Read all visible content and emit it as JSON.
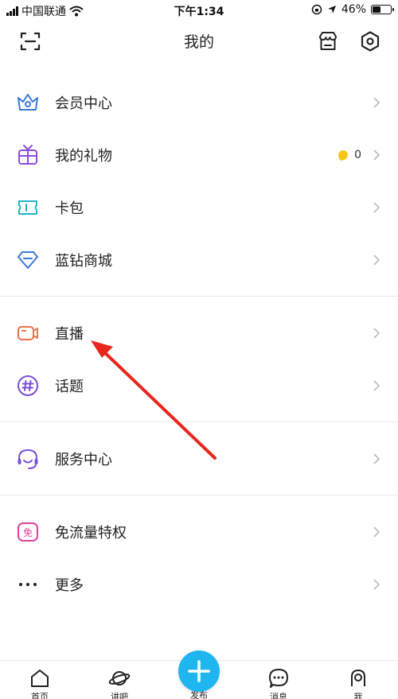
{
  "status_bar": {
    "carrier": "中国联通",
    "time": "下午1:34",
    "battery": "46%",
    "battery_level": 0.46
  },
  "header": {
    "title": "我的",
    "left_icon": "scan-icon",
    "right_icons": [
      "shop-icon",
      "settings-icon"
    ]
  },
  "menu_groups": [
    [
      {
        "label": "会员中心",
        "icon": "crown-icon"
      },
      {
        "label": "我的礼物",
        "icon": "gift-icon",
        "count": "0"
      },
      {
        "label": "卡包",
        "icon": "card-icon"
      },
      {
        "label": "蓝钻商城",
        "icon": "diamond-icon"
      }
    ],
    [
      {
        "label": "直播",
        "icon": "camera-icon"
      },
      {
        "label": "话题",
        "icon": "hashtag-icon"
      }
    ],
    [
      {
        "label": "服务中心",
        "icon": "headset-icon"
      }
    ],
    [
      {
        "label": "免流量特权",
        "icon": "free-data-icon",
        "icon_text": "免"
      },
      {
        "label": "更多",
        "icon": "more-icon"
      }
    ]
  ],
  "tab_bar": {
    "tabs": [
      {
        "label": "首页",
        "icon": "home-icon"
      },
      {
        "label": "讲吧",
        "icon": "planet-icon"
      },
      {
        "label": "发布",
        "icon": "plus-icon"
      },
      {
        "label": "消息",
        "icon": "message-icon"
      },
      {
        "label": "我",
        "icon": "profile-icon"
      }
    ]
  },
  "colors": {
    "accent_blue": "#1fb6f0",
    "crown": "#3a78d8",
    "gift": "#8a4fd8",
    "card": "#1fb6c8",
    "diamond": "#3a78d8",
    "live": "#f0704a",
    "topic": "#7a4fd8",
    "service": "#7a4fd8",
    "free": "#e0409a",
    "annotation_arrow": "#e8261c"
  }
}
